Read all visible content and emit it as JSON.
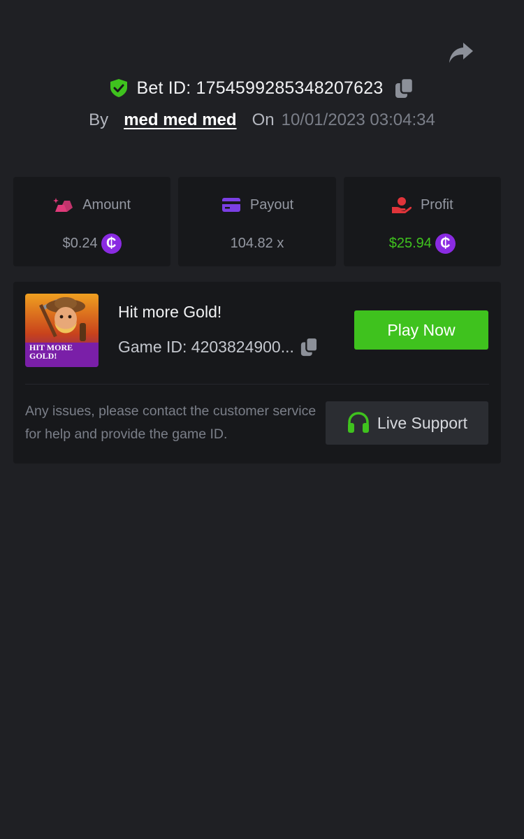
{
  "header": {
    "bet_id_text": "Bet ID: 1754599285348207623",
    "by_label": "By",
    "username": "med med med",
    "on_label": "On",
    "date": "10/01/2023 03:04:34"
  },
  "stats": [
    {
      "label": "Amount",
      "value": "$0.24",
      "icon": "gold-bars-icon",
      "currency": "₵"
    },
    {
      "label": "Payout",
      "value": "104.82 x",
      "icon": "card-icon"
    },
    {
      "label": "Profit",
      "value": "$25.94",
      "icon": "hand-coin-icon",
      "currency": "₵"
    }
  ],
  "game": {
    "title": "Hit more Gold!",
    "game_id": "Game ID: 4203824900...",
    "thumbnail_text_line1": "HIT MORE",
    "thumbnail_text_line2": "GOLD!",
    "play_label": "Play Now"
  },
  "support": {
    "help_text": "Any issues, please contact the customer service for help and provide the game ID.",
    "button_label": "Live Support"
  },
  "colors": {
    "background": "#1f2024",
    "card": "#17181b",
    "accent_green": "#3fc21e",
    "coin_purple": "#8a2be2",
    "amount_pink": "#e03a7a",
    "payout_purple": "#7b3fe4",
    "profit_red": "#e0343a"
  }
}
